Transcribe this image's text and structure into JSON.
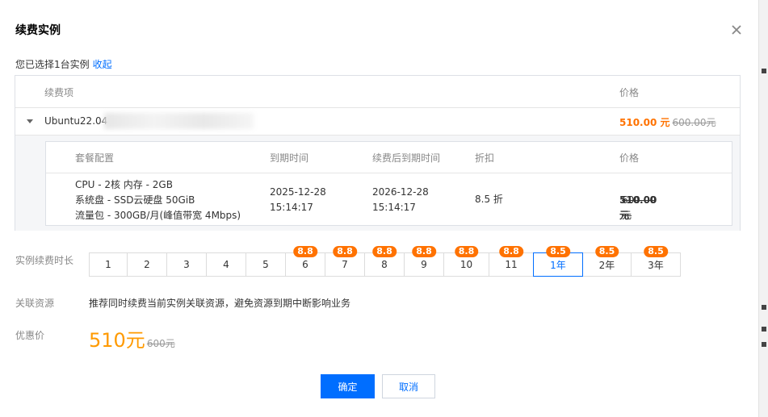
{
  "dialog": {
    "title": "续费实例",
    "selected_text": "您已选择1台实例",
    "collapse_label": "收起"
  },
  "outer_table": {
    "headers": {
      "item": "续费项",
      "price": "价格"
    },
    "row": {
      "instance_name": "Ubuntu22.04",
      "price_now": "510.00 元",
      "price_old": "600.00元"
    }
  },
  "inner_table": {
    "headers": {
      "config": "套餐配置",
      "expire": "到期时间",
      "renew_expire": "续费后到期时间",
      "discount": "折扣",
      "price": "价格"
    },
    "row": {
      "config_line1": "CPU - 2核 内存 - 2GB",
      "config_line2": "系统盘 - SSD云硬盘 50GiB",
      "config_line3": "流量包 - 300GB/月(峰值带宽 4Mbps)",
      "expire_date": "2025-12-28",
      "expire_time": "15:14:17",
      "renew_date": "2026-12-28",
      "renew_time": "15:14:17",
      "discount": "8.5 折",
      "price_now": "510.00 元",
      "price_old": "600.00元"
    }
  },
  "duration": {
    "label": "实例续费时长",
    "options": [
      {
        "label": "1",
        "badge": ""
      },
      {
        "label": "2",
        "badge": ""
      },
      {
        "label": "3",
        "badge": ""
      },
      {
        "label": "4",
        "badge": ""
      },
      {
        "label": "5",
        "badge": ""
      },
      {
        "label": "6",
        "badge": "8.8"
      },
      {
        "label": "7",
        "badge": "8.8"
      },
      {
        "label": "8",
        "badge": "8.8"
      },
      {
        "label": "9",
        "badge": "8.8"
      },
      {
        "label": "10",
        "badge": "8.8"
      },
      {
        "label": "11",
        "badge": "8.8"
      },
      {
        "label": "1年",
        "badge": "8.5",
        "selected": true
      },
      {
        "label": "2年",
        "badge": "8.5"
      },
      {
        "label": "3年",
        "badge": "8.5"
      }
    ]
  },
  "related": {
    "label": "关联资源",
    "text": "推荐同时续费当前实例关联资源，避免资源到期中断影响业务"
  },
  "discount_price": {
    "label": "优惠价",
    "now": "510元",
    "old": "600元"
  },
  "buttons": {
    "ok": "确定",
    "cancel": "取消"
  },
  "colors": {
    "accent": "#006eff",
    "price": "#ff7200",
    "badge": "#ff7200"
  }
}
